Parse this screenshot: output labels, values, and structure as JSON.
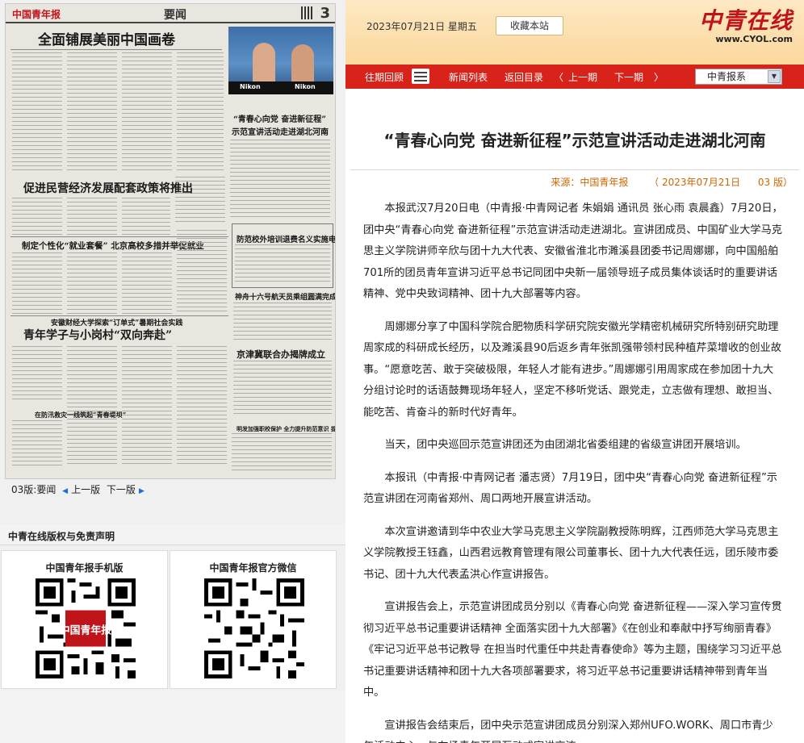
{
  "left": {
    "paper": {
      "masthead_logo": "中国青年报",
      "section": "要闻",
      "page_number": "3",
      "headlines": {
        "h1": "全面铺展美丽中国画卷",
        "h2": "促进民营经济发展配套政策将推出",
        "h3": "制定个性化“就业套餐”  北京高校多措并举促就业",
        "h4": "安徽财经大学探索“订单式”暑期社会实践",
        "h5": "青年学子与小岗村“双向奔赴”",
        "h6": "“青春心向党  奋进新征程”",
        "h7": "示范宣讲活动走进湖北河南",
        "h8": "防范校外培训退费名义实施电诈",
        "h9": "神舟十六号航天员乘组圆满完成出舱活动",
        "h10": "京津冀联合办揭牌成立",
        "h11": "在防汛救灾一线筑起“青春堤坝”",
        "h12": "明发加强职校保护  全力提升防范意识  提高防范能力"
      },
      "photo_labels": [
        "Nikon",
        "Nikon"
      ]
    },
    "pager": {
      "current": "03版:要闻",
      "prev": "上一版",
      "next": "下一版"
    },
    "copyright_title": "中青在线版权与免责声明",
    "qr_mobile_title": "中国青年报手机版",
    "qr_wechat_title": "中国青年报官方微信",
    "qr_logo": "中国青年报"
  },
  "right": {
    "date": "2023年07月21日  星期五",
    "favorite_label": "收藏本站",
    "brand_cn": "中青在线",
    "brand_url": "www.CYOL.com",
    "nav": {
      "archive": "往期回顾",
      "news_list": "新闻列表",
      "back_to_index": "返回目录",
      "prev_issue": "上一期",
      "next_issue": "下一期",
      "paper_select": "中青报系"
    },
    "headline": "“青春心向党  奋进新征程”示范宣讲活动走进湖北河南",
    "source_label": "来源：中国青年报",
    "source_date": "（  2023年07月21日",
    "source_page": "03 版）",
    "paragraphs": [
      "本报武汉7月20日电（中青报·中青网记者   朱娟娟   通讯员   张心雨   袁晨鑫）7月20日，团中央“青春心向党   奋进新征程”示范宣讲活动走进湖北。宣讲团成员、中国矿业大学马克思主义学院讲师辛欣与团十九大代表、安徽省淮北市濉溪县团委书记周娜娜，向中国船舶701所的团员青年宣讲习近平总书记同团中央新一届领导班子成员集体谈话时的重要讲话精神、党中央致词精神、团十九大部署等内容。",
      "周娜娜分享了中国科学院合肥物质科学研究院安徽光学精密机械研究所特别研究助理周家成的科研成长经历，以及濉溪县90后返乡青年张凯强带领村民种植芹菜增收的创业故事。“愿意吃苦、敢于突破极限，年轻人才能有进步。”周娜娜引用周家成在参加团十九大分组讨论时的话语鼓舞现场年轻人，坚定不移听党话、跟党走，立志做有理想、敢担当、能吃苦、肯奋斗的新时代好青年。",
      "当天，团中央巡回示范宣讲团还为由团湖北省委组建的省级宣讲团开展培训。",
      "本报讯（中青报·中青网记者  潘志贤）7月19日，团中央“青春心向党   奋进新征程”示范宣讲团在河南省郑州、周口两地开展宣讲活动。",
      "本次宣讲邀请到华中农业大学马克思主义学院副教授陈明辉，江西师范大学马克思主义学院教授王钰鑫，山西君远教育管理有限公司董事长、团十九大代表任远，团乐陵市委书记、团十九大代表孟洪心作宣讲报告。",
      "宣讲报告会上，示范宣讲团成员分别以《青春心向党   奋进新征程——深入学习宣传贯彻习近平总书记重要讲话精神   全面落实团十九大部署》《在创业和奉献中抒写绚丽青春》《牢记习近平总书记教导   在担当时代重任中共赴青春使命》等为主题，围绕学习习近平总书记重要讲话精神和团十九大各项部署要求，将习近平总书记重要讲话精神带到青年当中。",
      "宣讲报告会结束后，团中央示范宣讲团成员分别深入郑州UFO.WORK、周口市青少年活动中心，与在场青年开展互动式宣讲交流。"
    ]
  }
}
